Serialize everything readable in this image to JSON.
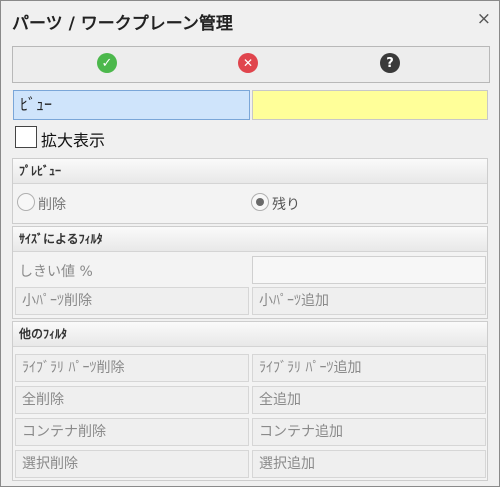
{
  "window": {
    "title": "パーツ / ワークプレーン管理",
    "close_glyph": "×"
  },
  "toolbar": {
    "buttons": [
      {
        "name": "ok",
        "icon": "check-circle-icon",
        "color": "#4cb84c",
        "glyph": "✓"
      },
      {
        "name": "cancel",
        "icon": "x-circle-icon",
        "color": "#e0454d",
        "glyph": "✕"
      },
      {
        "name": "help",
        "icon": "question-circle-icon",
        "color": "#3a3a3a",
        "glyph": "?"
      }
    ]
  },
  "view": {
    "value": "ﾋﾞｭｰ",
    "yellow_value": ""
  },
  "enlarge": {
    "label": "拡大表示",
    "checked": false
  },
  "preview": {
    "title": "ﾌﾟﾚﾋﾞｭｰ",
    "delete_label": "削除",
    "keep_label": "残り",
    "selected": "keep"
  },
  "size_filter": {
    "title": "ｻｲｽﾞによるﾌｨﾙﾀ",
    "threshold_label": "しきい値 %",
    "threshold_value": "",
    "small_delete": "小ﾊﾟｰﾂ削除",
    "small_add": "小ﾊﾟｰﾂ追加"
  },
  "other_filter": {
    "title": "他のﾌｨﾙﾀ",
    "rows": [
      {
        "left": "ﾗｲﾌﾞﾗﾘ ﾊﾟｰﾂ削除",
        "right": "ﾗｲﾌﾞﾗﾘ ﾊﾟｰﾂ追加"
      },
      {
        "left": "全削除",
        "right": "全追加"
      },
      {
        "left": "コンテナ削除",
        "right": "コンテナ追加"
      },
      {
        "left": "選択削除",
        "right": "選択追加"
      }
    ]
  }
}
